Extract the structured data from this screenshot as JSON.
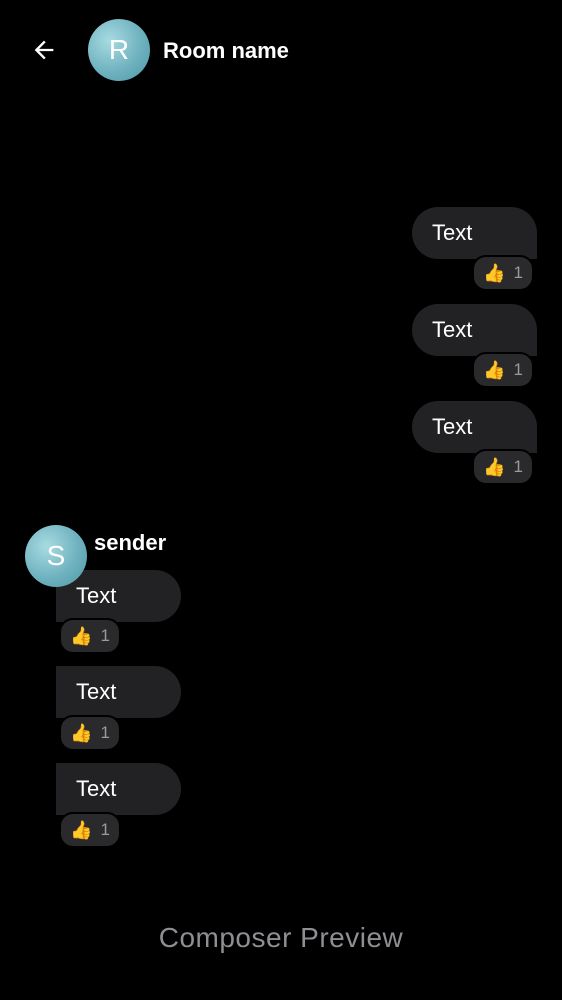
{
  "header": {
    "room_avatar_initial": "R",
    "room_name": "Room name",
    "back_icon": "arrow-left-icon"
  },
  "sender": {
    "avatar_initial": "S",
    "name": "sender"
  },
  "outgoing_messages": [
    {
      "text": "Text",
      "reaction_emoji": "👍",
      "reaction_count": "1"
    },
    {
      "text": "Text",
      "reaction_emoji": "👍",
      "reaction_count": "1"
    },
    {
      "text": "Text",
      "reaction_emoji": "👍",
      "reaction_count": "1"
    }
  ],
  "incoming_messages": [
    {
      "text": "Text",
      "reaction_emoji": "👍",
      "reaction_count": "1"
    },
    {
      "text": "Text",
      "reaction_emoji": "👍",
      "reaction_count": "1"
    },
    {
      "text": "Text",
      "reaction_emoji": "👍",
      "reaction_count": "1"
    }
  ],
  "composer": {
    "preview_text": "Composer Preview"
  },
  "colors": {
    "background": "#000000",
    "bubble": "#222224",
    "reaction_bg": "#2a2a2c",
    "avatar": "#6fb2bf",
    "muted_text": "#8e8e93"
  }
}
